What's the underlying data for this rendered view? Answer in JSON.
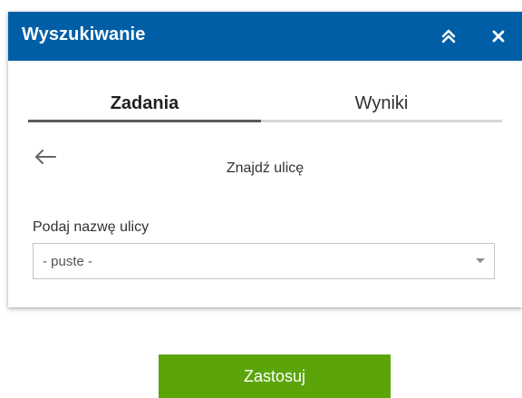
{
  "panel": {
    "title": "Wyszukiwanie",
    "collapse_icon": "chevron-double-up-icon",
    "close_icon": "close-icon"
  },
  "tabs": [
    {
      "label": "Zadania",
      "active": true
    },
    {
      "label": "Wyniki",
      "active": false
    }
  ],
  "task": {
    "back_icon": "arrow-left-icon",
    "title": "Znajdź ulicę"
  },
  "street_field": {
    "label": "Podaj nazwę ulicy",
    "value": "- puste -"
  },
  "apply_button": {
    "label": "Zastosuj"
  },
  "colors": {
    "header_bg": "#005ea6",
    "apply_bg": "#5ba50b"
  }
}
